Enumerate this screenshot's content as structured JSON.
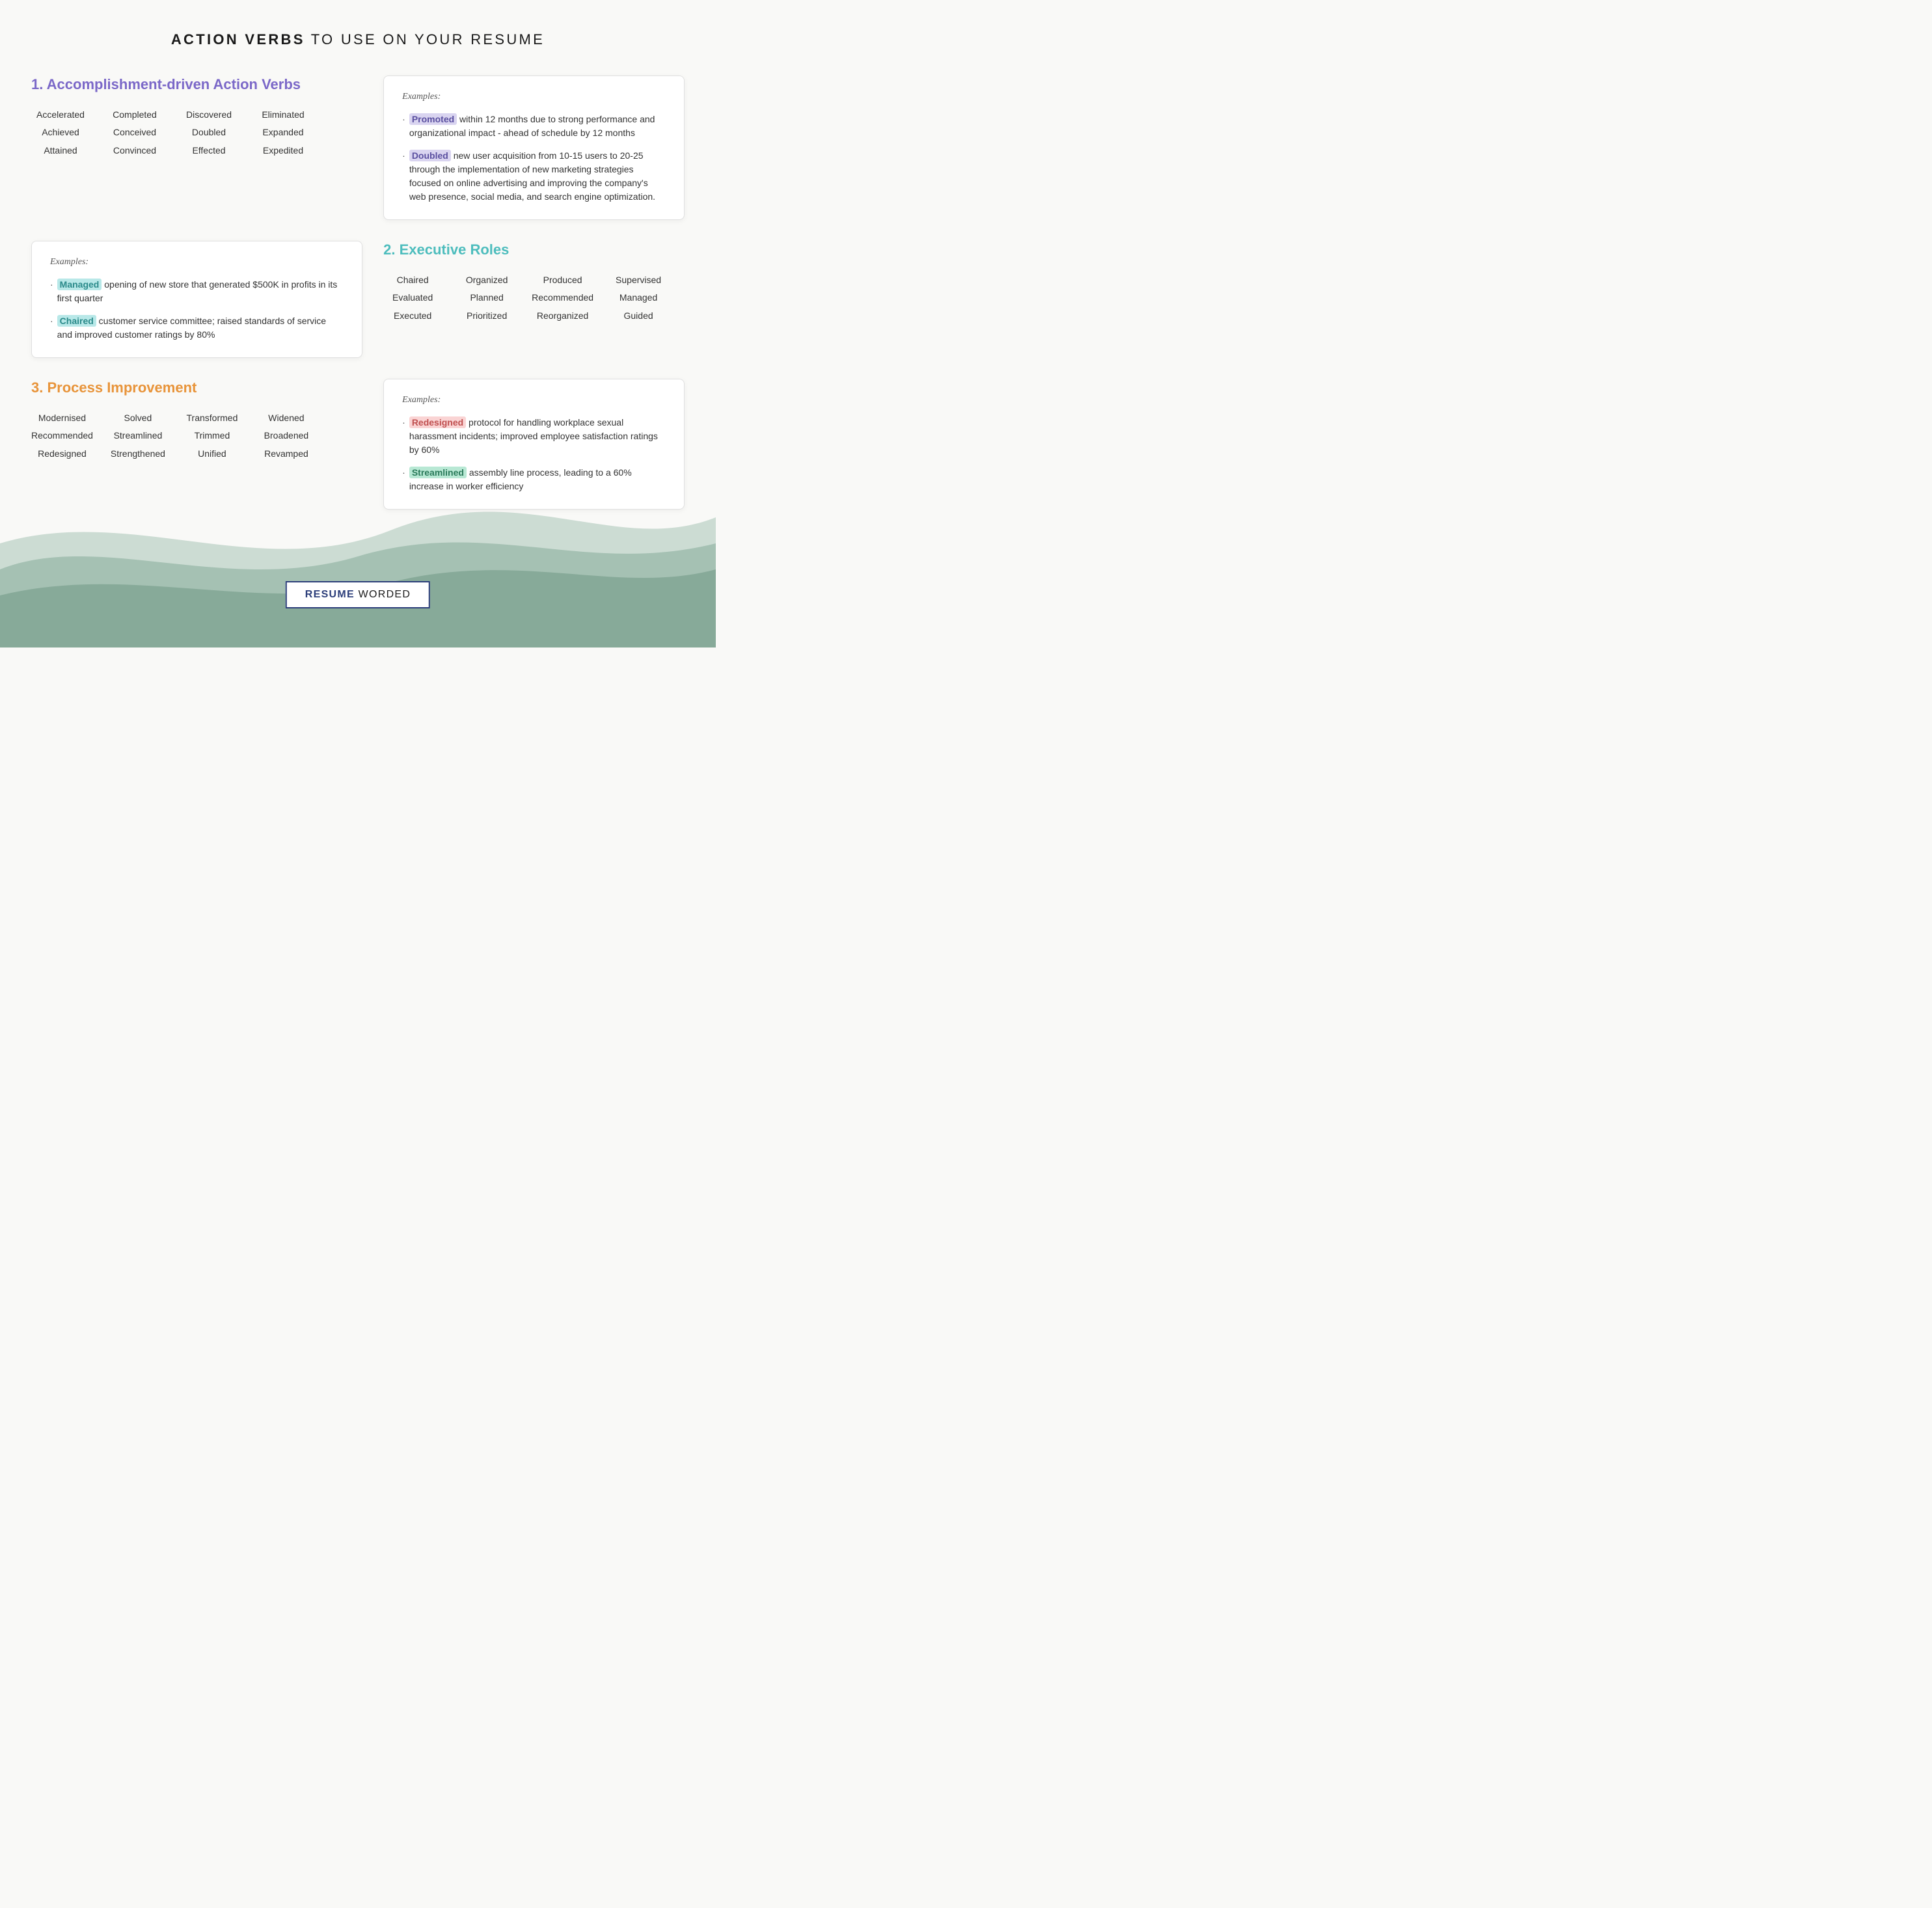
{
  "header": {
    "bold_part": "ACTION VERBS",
    "rest_part": " TO USE ON YOUR RESUME"
  },
  "section1": {
    "title": "1. Accomplishment-driven Action Verbs",
    "words": [
      [
        "Accelerated",
        "Achieved",
        "Attained"
      ],
      [
        "Completed",
        "Conceived",
        "Convinced"
      ],
      [
        "Discovered",
        "Doubled",
        "Effected"
      ],
      [
        "Eliminated",
        "Expanded",
        "Expedited"
      ]
    ],
    "examples_label": "Examples:",
    "examples": [
      {
        "highlight": "Promoted",
        "highlight_class": "purple",
        "rest": " within 12 months due to strong performance and organizational impact - ahead of schedule by 12 months"
      },
      {
        "highlight": "Doubled",
        "highlight_class": "purple",
        "rest": " new user acquisition from 10-15 users to 20-25 through the implementation of new marketing strategies focused on online advertising and improving the company's web presence, social media, and search engine optimization."
      }
    ]
  },
  "section1_box": {
    "examples_label": "Examples:",
    "examples": [
      {
        "highlight": "Managed",
        "highlight_class": "teal",
        "rest": " opening of new store that generated $500K in profits in its first quarter"
      },
      {
        "highlight": "Chaired",
        "highlight_class": "teal",
        "rest": " customer service committee; raised standards of service and improved customer ratings by 80%"
      }
    ]
  },
  "section2": {
    "title": "2. Executive Roles",
    "title_class": "teal",
    "words": [
      [
        "Chaired",
        "Evaluated",
        "Executed"
      ],
      [
        "Organized",
        "Planned",
        "Prioritized"
      ],
      [
        "Produced",
        "Recommended",
        "Reorganized"
      ],
      [
        "Supervised",
        "Managed",
        "Guided"
      ]
    ]
  },
  "section3": {
    "title": "3. Process Improvement",
    "title_class": "orange",
    "words": [
      [
        "Modernised",
        "Recommended",
        "Redesigned"
      ],
      [
        "Solved",
        "Streamlined",
        "Strengthened"
      ],
      [
        "Transformed",
        "Trimmed",
        "Unified"
      ],
      [
        "Widened",
        "Broadened",
        "Revamped"
      ]
    ],
    "examples_label": "Examples:",
    "examples": [
      {
        "highlight": "Redesigned",
        "highlight_class": "pink",
        "rest": " protocol for handling workplace sexual harassment incidents; improved employee satisfaction ratings by 60%"
      },
      {
        "highlight": "Streamlined",
        "highlight_class": "green",
        "rest": " assembly line process, leading to a 60% increase in worker efficiency"
      }
    ]
  },
  "logo": {
    "bold": "RESUME",
    "rest": " WORDED"
  }
}
